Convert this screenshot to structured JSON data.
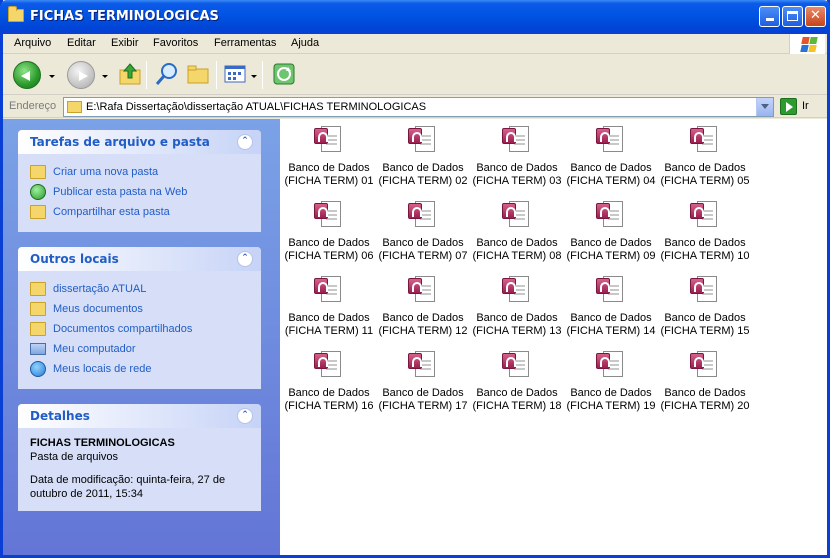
{
  "window": {
    "title": "FICHAS TERMINOLOGICAS",
    "minimize_icon": "minimize-icon",
    "maximize_icon": "maximize-icon",
    "close_icon": "close-icon"
  },
  "menu": [
    "Arquivo",
    "Editar",
    "Exibir",
    "Favoritos",
    "Ferramentas",
    "Ajuda"
  ],
  "address": {
    "label": "Endereço",
    "value": "E:\\Rafa Dissertação\\dissertação ATUAL\\FICHAS TERMINOLOGICAS",
    "go_label": "Ir"
  },
  "tasks_panel": {
    "title": "Tarefas de arquivo e pasta",
    "items": [
      {
        "label": "Criar uma nova pasta",
        "icon": "new-folder-icon"
      },
      {
        "label": "Publicar esta pasta na Web",
        "icon": "publish-web-icon"
      },
      {
        "label": "Compartilhar esta pasta",
        "icon": "share-folder-icon"
      }
    ]
  },
  "places_panel": {
    "title": "Outros locais",
    "items": [
      {
        "label": "dissertação ATUAL",
        "icon": "folder-icon"
      },
      {
        "label": "Meus documentos",
        "icon": "my-documents-icon"
      },
      {
        "label": "Documentos compartilhados",
        "icon": "shared-documents-icon"
      },
      {
        "label": "Meu computador",
        "icon": "my-computer-icon"
      },
      {
        "label": "Meus locais de rede",
        "icon": "network-places-icon"
      }
    ]
  },
  "details_panel": {
    "title": "Detalhes",
    "name": "FICHAS TERMINOLOGICAS",
    "type": "Pasta de arquivos",
    "modified_line1": "Data de modificação: quinta-feira, 27 de",
    "modified_line2": "outubro de 2011, 15:34"
  },
  "files": [
    {
      "line1": "Banco de Dados",
      "line2": "(FICHA TERM) 01"
    },
    {
      "line1": "Banco de Dados",
      "line2": "(FICHA TERM) 02"
    },
    {
      "line1": "Banco de Dados",
      "line2": "(FICHA TERM) 03"
    },
    {
      "line1": "Banco de Dados",
      "line2": "(FICHA TERM) 04"
    },
    {
      "line1": "Banco de Dados",
      "line2": "(FICHA TERM) 05"
    },
    {
      "line1": "Banco de Dados",
      "line2": "(FICHA TERM) 06"
    },
    {
      "line1": "Banco de Dados",
      "line2": "(FICHA TERM) 07"
    },
    {
      "line1": "Banco de Dados",
      "line2": "(FICHA TERM) 08"
    },
    {
      "line1": "Banco de Dados",
      "line2": "(FICHA TERM) 09"
    },
    {
      "line1": "Banco de Dados",
      "line2": "(FICHA TERM) 10"
    },
    {
      "line1": "Banco de Dados",
      "line2": "(FICHA TERM) 11"
    },
    {
      "line1": "Banco de Dados",
      "line2": "(FICHA TERM) 12"
    },
    {
      "line1": "Banco de Dados",
      "line2": "(FICHA TERM) 13"
    },
    {
      "line1": "Banco de Dados",
      "line2": "(FICHA TERM) 14"
    },
    {
      "line1": "Banco de Dados",
      "line2": "(FICHA TERM) 15"
    },
    {
      "line1": "Banco de Dados",
      "line2": "(FICHA TERM) 16"
    },
    {
      "line1": "Banco de Dados",
      "line2": "(FICHA TERM) 17"
    },
    {
      "line1": "Banco de Dados",
      "line2": "(FICHA TERM) 18"
    },
    {
      "line1": "Banco de Dados",
      "line2": "(FICHA TERM) 19"
    },
    {
      "line1": "Banco de Dados",
      "line2": "(FICHA TERM) 20"
    }
  ],
  "colors": {
    "titlebar": "#0054e3",
    "task_link": "#215dc6",
    "panel_bg": "#d6dff7",
    "sidebar_bg": "#6375d6"
  }
}
